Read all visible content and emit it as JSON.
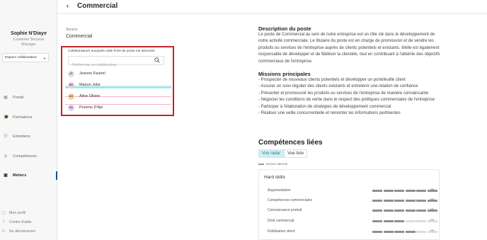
{
  "user": {
    "name": "Sophie N'Diaye",
    "role": "Customer Success Manager"
  },
  "space_select": {
    "value": "Espace collaborateur"
  },
  "nav": [
    {
      "label": "Portail",
      "icon": "grid-icon",
      "glyph": "▦",
      "active": false
    },
    {
      "label": "Formations",
      "icon": "graduation-cap-icon",
      "glyph": "🎓",
      "active": false
    },
    {
      "label": "Entretiens",
      "icon": "people-icon",
      "glyph": "☷",
      "active": false
    },
    {
      "label": "Compétences",
      "icon": "target-icon",
      "glyph": "◎",
      "active": false
    },
    {
      "label": "Métiers",
      "icon": "briefcase-icon",
      "glyph": "▣",
      "active": true
    }
  ],
  "footer_links": [
    {
      "label": "Mon profil",
      "icon": "user-icon",
      "glyph": "◯"
    },
    {
      "label": "Centre d'aide",
      "icon": "help-icon",
      "glyph": "?"
    },
    {
      "label": "Se déconnecter",
      "icon": "logout-icon",
      "glyph": "⏻"
    }
  ],
  "header": {
    "back_glyph": "‹",
    "title": "Commercial"
  },
  "service": {
    "label": "Service",
    "value": "Commercial"
  },
  "collaborators": {
    "title": "Collaborateurs auxquels cette fiche de poste est associée",
    "search_placeholder": "Rechercher un collaborateur",
    "items": [
      {
        "initials": "JF",
        "name": "Jeanne Fautrel",
        "color": "#d9dde8"
      },
      {
        "initials": "MJ",
        "name": "Manon Jolie",
        "color": "#f3c9e2"
      },
      {
        "initials": "AO",
        "name": "Aline Olivier",
        "color": "#f6d09a"
      },
      {
        "initials": "PD",
        "name": "Pomme D'Api",
        "color": "#dcd4ee"
      }
    ],
    "border_color": "#c3232b"
  },
  "description": {
    "title": "Description du poste",
    "text": "Le poste de Commercial au sein de notre entreprise est un rôle clé dans le développement de notre activité commerciale. Le titulaire du poste est en charge de promouvoir et de vendre les produits ou services de l'entreprise auprès de clients potentiels et existants. Il/elle est également responsable de développer et de fidéliser la clientèle, tout en contribuant à l'atteinte des objectifs commerciaux de l'entreprise."
  },
  "missions": {
    "title": "Missions principales",
    "items": [
      "- Prospecter de nouveaux clients potentiels et développer un portefeuille client",
      "- Assurer un suivi régulier des clients existants et entretenir une relation de confiance",
      "- Présenter et promouvoir les produits ou services de l'entreprise de manière convaincante",
      "- Négocier les conditions de vente dans le respect des politiques commerciales de l'entreprise",
      "- Participer à l'élaboration de stratégies de développement commercial",
      "- Réaliser une veille concurrentielle et remonter les informations pertinentes"
    ]
  },
  "competences": {
    "title": "Compétences liées",
    "tabs": [
      {
        "label": "Vue radar",
        "active": true
      },
      {
        "label": "Vue liste",
        "active": false
      }
    ],
    "legend": "Niveau attendu",
    "hard_skills": {
      "title": "Hard skills",
      "max_level": 6,
      "items": [
        {
          "label": "Argumentation",
          "level": 6
        },
        {
          "label": "Compétences commerciales",
          "level": 6
        },
        {
          "label": "Connaissance produit",
          "level": 6
        },
        {
          "label": "Droit commercial",
          "level": 3
        },
        {
          "label": "Fidélisation client",
          "level": 4
        }
      ]
    }
  }
}
